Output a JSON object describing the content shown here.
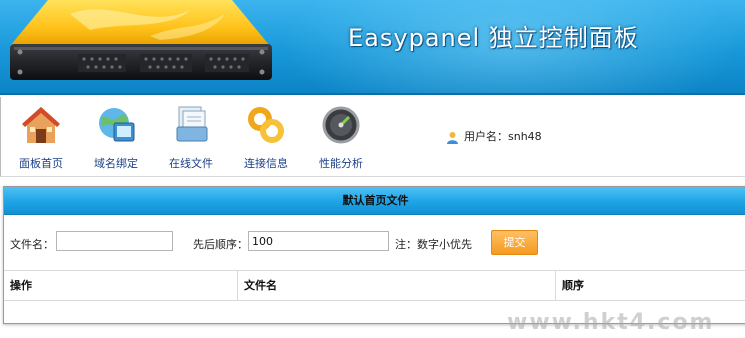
{
  "header": {
    "title": "Easypanel  独立控制面板"
  },
  "nav": {
    "items": [
      {
        "label": "面板首页",
        "icon": "home-icon"
      },
      {
        "label": "域名绑定",
        "icon": "globe-icon"
      },
      {
        "label": "在线文件",
        "icon": "file-manager-icon"
      },
      {
        "label": "连接信息",
        "icon": "connection-link-icon"
      },
      {
        "label": "性能分析",
        "icon": "performance-gauge-icon"
      }
    ],
    "user_text": "用户名：snh48"
  },
  "panel": {
    "title": "默认首页文件",
    "filename_label": "文件名：",
    "filename_value": "",
    "order_label": "先后顺序：",
    "order_value": "100",
    "note": "注：数字小优先",
    "submit_label": "提交",
    "columns": [
      "操作",
      "文件名",
      "顺序"
    ]
  },
  "watermark": "www.hkt4.com",
  "colors": {
    "banner_blue": "#1898d9",
    "nav_label": "#1a3f88",
    "submit_orange": "#f59a22"
  }
}
